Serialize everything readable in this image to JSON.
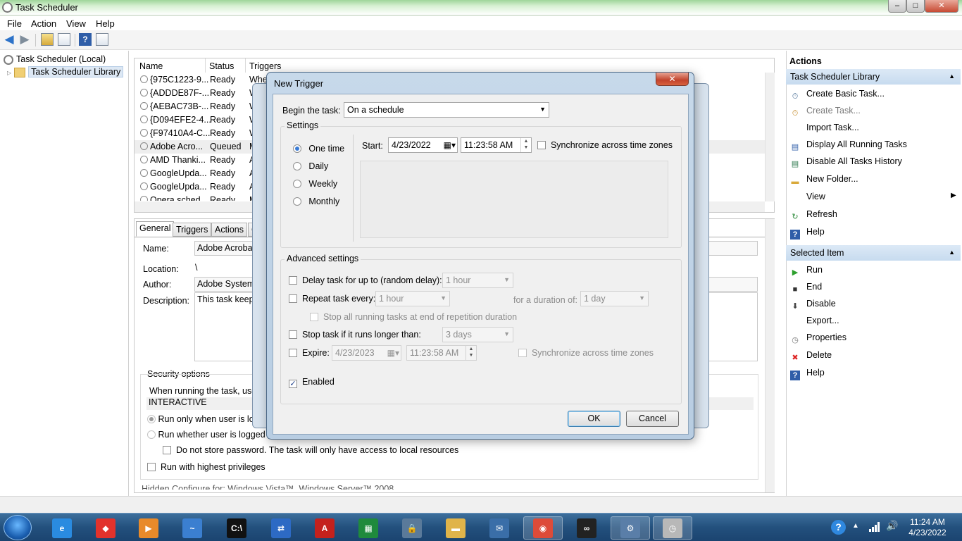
{
  "window": {
    "title": "Task Scheduler",
    "controls": {
      "minimize": "–",
      "maximize": "□",
      "close": "✕"
    }
  },
  "menu": [
    "File",
    "Action",
    "View",
    "Help"
  ],
  "tree": {
    "root": "Task Scheduler (Local)",
    "library": "Task Scheduler Library"
  },
  "task_list": {
    "columns": [
      "Name",
      "Status",
      "Triggers"
    ],
    "rows": [
      {
        "name": "{975C1223-9...",
        "status": "Ready",
        "trigger": "When"
      },
      {
        "name": "{ADDDE87F-...",
        "status": "Ready",
        "trigger": "W"
      },
      {
        "name": "{AEBAC73B-...",
        "status": "Ready",
        "trigger": "W"
      },
      {
        "name": "{D094EFE2-4...",
        "status": "Ready",
        "trigger": "W"
      },
      {
        "name": "{F97410A4-C...",
        "status": "Ready",
        "trigger": "W"
      },
      {
        "name": "Adobe Acro...",
        "status": "Queued",
        "trigger": "M"
      },
      {
        "name": "AMD Thanki...",
        "status": "Ready",
        "trigger": "A"
      },
      {
        "name": "GoogleUpda...",
        "status": "Ready",
        "trigger": "A"
      },
      {
        "name": "GoogleUpda...",
        "status": "Ready",
        "trigger": "A"
      },
      {
        "name": "Opera sched...",
        "status": "Ready",
        "trigger": "M"
      }
    ]
  },
  "details": {
    "tabs": [
      "General",
      "Triggers",
      "Actions",
      "C"
    ],
    "name_label": "Name:",
    "name_value": "Adobe Acrobat",
    "location_label": "Location:",
    "location_value": "\\",
    "author_label": "Author:",
    "author_value": "Adobe Systems",
    "description_label": "Description:",
    "description_value": "This task keeps",
    "security_title": "Security options",
    "running_as": "When running the task, use t",
    "account": "INTERACTIVE",
    "run_only_logged": "Run only when user is log",
    "run_whether": "Run whether user is logged o",
    "no_store_password": "Do not store password.  The task will only have access to local resources",
    "highest_priv": "Run with highest privileges",
    "hidden_cut": "Hidden      Configure for:   Windows Vista™, Windows Server™ 2008"
  },
  "actions_pane": {
    "header": "Actions",
    "library_section": "Task Scheduler Library",
    "library_items": [
      {
        "label": "Create Basic Task...",
        "icon": "create-basic-task-icon",
        "disabled": false
      },
      {
        "label": "Create Task...",
        "icon": "create-task-icon",
        "disabled": true
      },
      {
        "label": "Import Task...",
        "icon": "",
        "disabled": false
      },
      {
        "label": "Display All Running Tasks",
        "icon": "running-tasks-icon",
        "disabled": false
      },
      {
        "label": "Disable All Tasks History",
        "icon": "history-icon",
        "disabled": false
      },
      {
        "label": "New Folder...",
        "icon": "folder-icon",
        "disabled": false
      },
      {
        "label": "View",
        "icon": "",
        "disabled": false
      },
      {
        "label": "Refresh",
        "icon": "refresh-icon",
        "disabled": false
      },
      {
        "label": "Help",
        "icon": "help-icon",
        "disabled": false
      }
    ],
    "selected_section": "Selected Item",
    "selected_items": [
      {
        "label": "Run",
        "icon": "run-icon"
      },
      {
        "label": "End",
        "icon": "end-icon"
      },
      {
        "label": "Disable",
        "icon": "disable-icon"
      },
      {
        "label": "Export...",
        "icon": ""
      },
      {
        "label": "Properties",
        "icon": "properties-icon"
      },
      {
        "label": "Delete",
        "icon": "delete-icon"
      },
      {
        "label": "Help",
        "icon": "help-icon"
      }
    ]
  },
  "dialog": {
    "title": "New Trigger",
    "close": "✕",
    "begin_label": "Begin the task:",
    "begin_value": "On a schedule",
    "settings_title": "Settings",
    "frequency": [
      "One time",
      "Daily",
      "Weekly",
      "Monthly"
    ],
    "frequency_selected": "One time",
    "start_label": "Start:",
    "start_date": "4/23/2022",
    "start_time": "11:23:58 AM",
    "sync_label": "Synchronize across time zones",
    "advanced_title": "Advanced settings",
    "delay_label": "Delay task for up to (random delay):",
    "delay_value": "1 hour",
    "repeat_label": "Repeat task every:",
    "repeat_value": "1 hour",
    "duration_label": "for a duration of:",
    "duration_value": "1 day",
    "stop_all_label": "Stop all running tasks at end of repetition duration",
    "stop_longer_label": "Stop task if it runs longer than:",
    "stop_longer_value": "3 days",
    "expire_label": "Expire:",
    "expire_date": "4/23/2023",
    "expire_time": "11:23:58 AM",
    "expire_sync_label": "Synchronize across time zones",
    "enabled_label": "Enabled",
    "enabled_checked": true,
    "ok": "OK",
    "cancel": "Cancel"
  },
  "taskbar": {
    "apps": [
      "ie",
      "anydesk",
      "media-player",
      "dolphin",
      "cmd",
      "network",
      "acrobat",
      "excel",
      "lock",
      "explorer",
      "mail",
      "chrome",
      "glasses",
      "settings",
      "task-scheduler"
    ],
    "help_glyph": "?",
    "time": "11:24 AM",
    "date": "4/23/2022"
  }
}
